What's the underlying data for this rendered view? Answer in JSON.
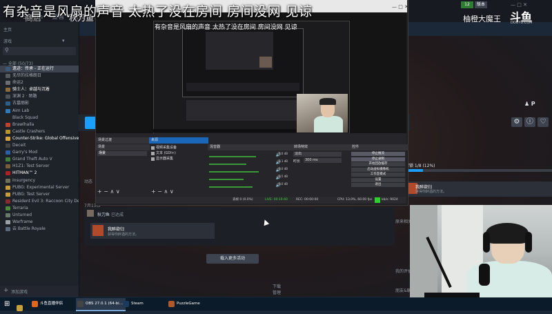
{
  "overlay": {
    "title": "有杂音是风扇的声音 太热了没在房间 房间没网 见谅",
    "inner_title": "有杂音是风扇的声音 太热了没在房间 房间没网 见谅"
  },
  "streamer": {
    "name": "柚橙大魔王",
    "logo": "斗鱼",
    "url": "DOUYU.COM"
  },
  "steam": {
    "menu": [
      "Steam",
      "查看",
      "好友",
      "游戏",
      "帮助"
    ],
    "nav_store": "商店",
    "nav_library": "秋刀鱼",
    "version_badges": [
      "12",
      "版本"
    ],
    "window_controls": "— □ ✕",
    "sidebar": {
      "home": "主页",
      "games_label": "游戏",
      "dropdown": "▾",
      "all_label": "— 全部 (50/73)",
      "items": [
        {
          "label": "遗迹：传承 - 正在运行",
          "color": "#3a5a7a",
          "state": "sel"
        },
        {
          "label": "无尽的拉格朗日",
          "color": "#555a5e",
          "state": ""
        },
        {
          "label": "命运2",
          "color": "#6b6f73",
          "state": ""
        },
        {
          "label": "骑士人：卓越与沉着",
          "color": "#8c6a3a",
          "state": "bold"
        },
        {
          "label": "深渊 2 · 陌路",
          "color": "#4d5258",
          "state": ""
        },
        {
          "label": "古墓丽影",
          "color": "#2a5f8a",
          "state": ""
        },
        {
          "label": "Aim Lab",
          "color": "#2f7ab8",
          "state": ""
        },
        {
          "label": "Black Squad",
          "color": "#222",
          "state": ""
        },
        {
          "label": "Brawlhalla",
          "color": "#c2412a",
          "state": ""
        },
        {
          "label": "Castle Crashers",
          "color": "#b8952c",
          "state": ""
        },
        {
          "label": "Counter-Strike: Global Offensive",
          "color": "#d7a440",
          "state": "bold"
        },
        {
          "label": "Deceit",
          "color": "#444",
          "state": ""
        },
        {
          "label": "Garry's Mod",
          "color": "#2b5fa8",
          "state": ""
        },
        {
          "label": "Grand Theft Auto V",
          "color": "#3f7f3a",
          "state": ""
        },
        {
          "label": "H1Z1: Test Server",
          "color": "#7b5c3a",
          "state": ""
        },
        {
          "label": "HITMAN™ 2",
          "color": "#b02020",
          "state": "bold"
        },
        {
          "label": "Insurgency",
          "color": "#6f6f5c",
          "state": ""
        },
        {
          "label": "PUBG: Experimental Server",
          "color": "#c89a3a",
          "state": ""
        },
        {
          "label": "PUBG: Test Server",
          "color": "#c89a3a",
          "state": ""
        },
        {
          "label": "Resident Evil 3: Raccoon City Demo",
          "color": "#8a2a2a",
          "state": ""
        },
        {
          "label": "Terraria",
          "color": "#4a8a3a",
          "state": ""
        },
        {
          "label": "Unturned",
          "color": "#6a7a6a",
          "state": ""
        },
        {
          "label": "Warframe",
          "color": "#9aa0a6",
          "state": ""
        },
        {
          "label": "云 Battle Royale",
          "color": "#5a6a7a",
          "state": ""
        }
      ],
      "add_game": "添加游戏"
    },
    "main": {
      "dynamics": "动态",
      "date": "7月13日",
      "activity_user": "秋刀鱼",
      "activity_suffix": "已达成",
      "ach_title": "我醉欲归",
      "ach_desc": "获得你醉酒的方法。",
      "load_more": "载入更多活动",
      "download": "下载",
      "download_sub": "管理",
      "ach_progress_label": "解锁 1/8 (12%)",
      "ach_progress": 0.12,
      "ach_title_right": "我醉欲归",
      "ach_desc_right": "获得你醉酒的方法。",
      "side_a": "原来相关",
      "side_b": "我的评价",
      "side_c": "朋友&聊天"
    },
    "right_icons": [
      "⚙",
      "ⓘ",
      "♡"
    ],
    "user_icons": "♟ 𝗣"
  },
  "obs": {
    "docks": {
      "scenes": "场景",
      "sources": "来源",
      "mixer": "混音器",
      "transitions": "转场特效",
      "controls": "控件",
      "scene_tab": "场景过渡",
      "scene_item": "场景"
    },
    "sources": [
      "视频采集设备",
      "文本 (GDI+)",
      "显示器采集"
    ],
    "mixer": [
      {
        "val": "0.0 dB",
        "fill": 0.75
      },
      {
        "val": "-2.1 dB",
        "fill": 0.6
      },
      {
        "val": "0.0 dB",
        "fill": 0.8
      },
      {
        "val": "-3.5 dB",
        "fill": 0.55
      },
      {
        "val": "0.0 dB",
        "fill": 0.7
      }
    ],
    "transition": "淡出",
    "duration_label": "时长",
    "duration": "300 ms",
    "controls": [
      "停止推流",
      "停止录制",
      "开始回放缓存",
      "启动虚拟摄像机",
      "工作室模式",
      "设置",
      "退出"
    ],
    "status": {
      "dropped": "丢帧 0 (0.0%)",
      "live": "LIVE: 00:19:40",
      "rec": "REC: 00:00:00",
      "cpu": "CPU: 13.0%, 60.00 fps",
      "kbps": "kb/s: 9024"
    },
    "tools": "+ − ∧ ∨"
  },
  "taskbar": {
    "start": "⊞",
    "items": [
      {
        "label": "斗鱼直播伴侣",
        "color": "#e0671f",
        "active": false
      },
      {
        "label": "OBS 27.0.1 (64-bi…",
        "color": "#444",
        "active": true
      },
      {
        "label": "Steam",
        "color": "#1a3b5e",
        "active": false
      },
      {
        "label": "PuzzleGame",
        "color": "#b05a2a",
        "active": false
      }
    ]
  }
}
